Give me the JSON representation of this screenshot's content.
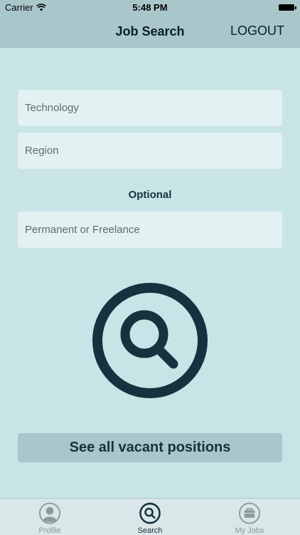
{
  "status_bar": {
    "carrier": "Carrier",
    "time": "5:48 PM"
  },
  "nav": {
    "title": "Job Search",
    "logout_label": "LOGOUT"
  },
  "form": {
    "technology_placeholder": "Technology",
    "region_placeholder": "Region",
    "optional_label": "Optional",
    "employment_type_placeholder": "Permanent or Freelance"
  },
  "see_all_label": "See all vacant positions",
  "tabs": [
    {
      "label": "Profile",
      "icon": "profile-icon",
      "active": false
    },
    {
      "label": "Search",
      "icon": "search-icon",
      "active": true
    },
    {
      "label": "My Jobs",
      "icon": "briefcase-icon",
      "active": false
    }
  ],
  "colors": {
    "background": "#c9e4e7",
    "bar": "#a9c7cb",
    "field": "#e2f1f1",
    "dark": "#16323e",
    "inactive": "#8a9a9e"
  }
}
